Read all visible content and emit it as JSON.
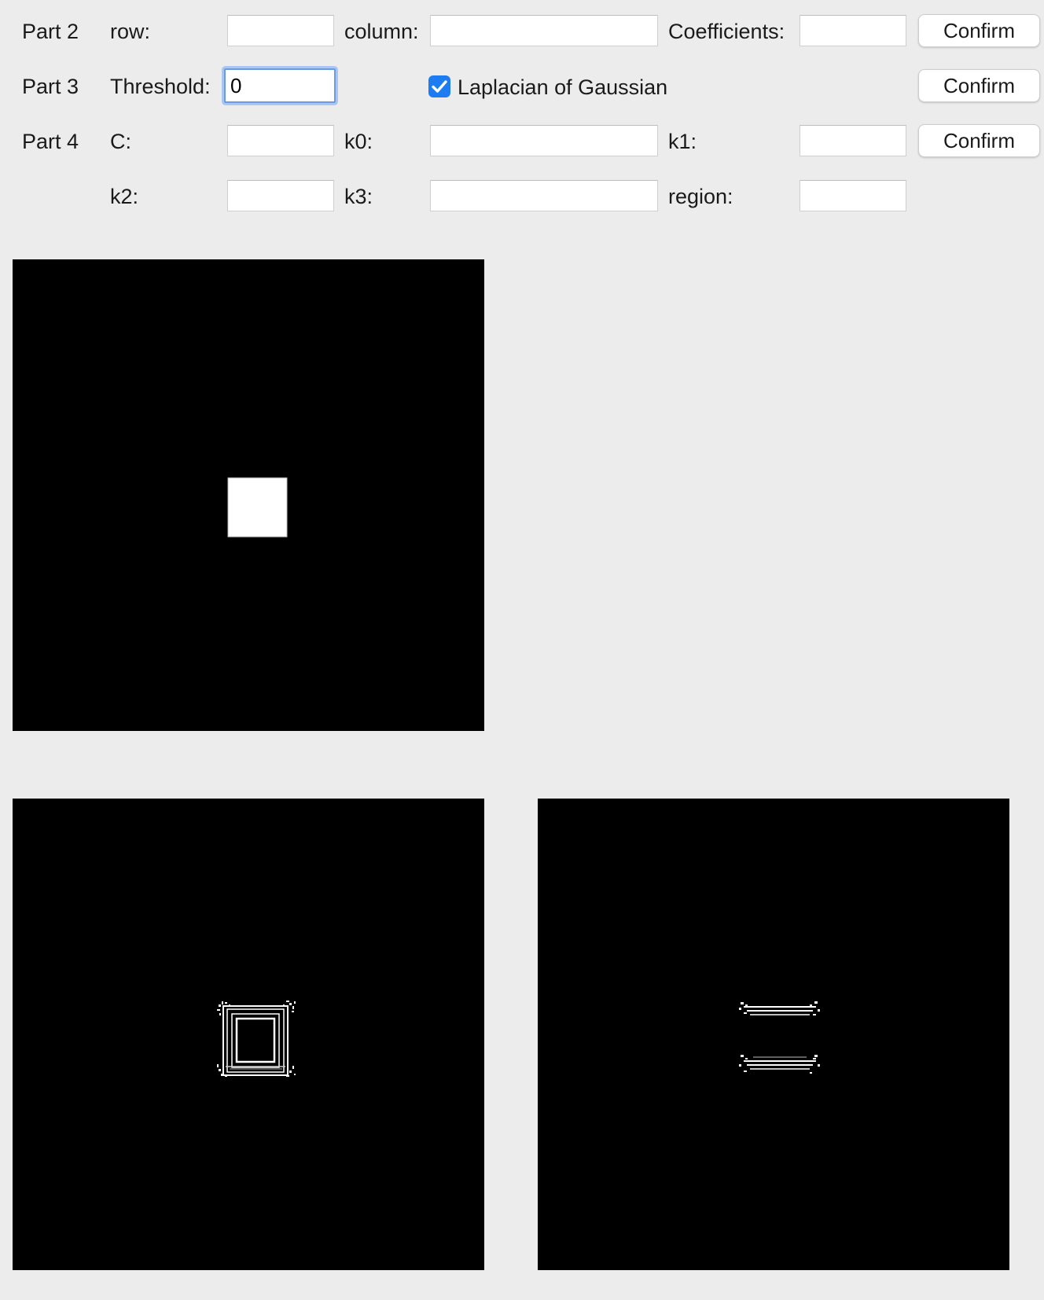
{
  "part2": {
    "label": "Part 2",
    "row_label": "row:",
    "row_value": "",
    "column_label": "column:",
    "column_value": "",
    "coefficients_label": "Coefficients:",
    "coefficients_value": "",
    "confirm_label": "Confirm"
  },
  "part3": {
    "label": "Part 3",
    "threshold_label": "Threshold:",
    "threshold_value": "0",
    "log_label": "Laplacian of Gaussian",
    "log_checked": true,
    "confirm_label": "Confirm"
  },
  "part4": {
    "label": "Part 4",
    "c_label": "C:",
    "c_value": "",
    "k0_label": "k0:",
    "k0_value": "",
    "k1_label": "k1:",
    "k1_value": "",
    "k2_label": "k2:",
    "k2_value": "",
    "k3_label": "k3:",
    "k3_value": "",
    "region_label": "region:",
    "region_value": "",
    "confirm_label": "Confirm"
  },
  "colors": {
    "background": "#ececec",
    "checkbox_accent": "#1e7cf2",
    "focus_ring": "#6b9ae8",
    "image_background": "#000000",
    "image_foreground": "#ffffff"
  },
  "images": {
    "original": "white square on black",
    "log_edges": "square outline edges",
    "region_edges": "horizontal edge segments"
  }
}
